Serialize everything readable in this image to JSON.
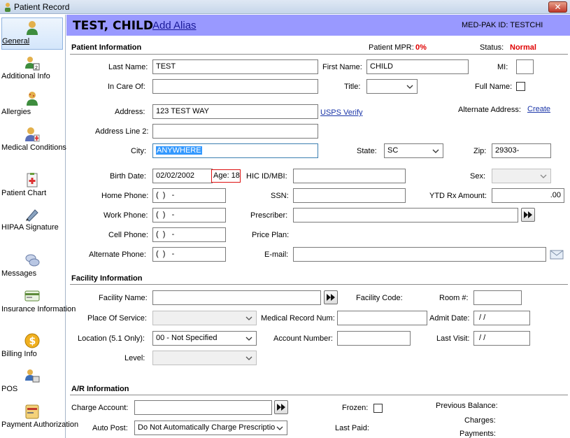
{
  "window": {
    "title": "Patient Record",
    "close_glyph": "✕"
  },
  "sidebar": {
    "items": [
      {
        "label": "General",
        "icon": "person-icon"
      },
      {
        "label": "Additional Info",
        "icon": "people-icon"
      },
      {
        "label": "Allergies",
        "icon": "allergy-icon"
      },
      {
        "label": "Medical Conditions",
        "icon": "medical-icon"
      },
      {
        "label": "Patient Chart",
        "icon": "chart-icon"
      },
      {
        "label": "HIPAA Signature",
        "icon": "pen-icon"
      },
      {
        "label": "Messages",
        "icon": "messages-icon"
      },
      {
        "label": "Insurance Information",
        "icon": "insurance-icon"
      },
      {
        "label": "Billing Info",
        "icon": "dollar-icon"
      },
      {
        "label": "POS",
        "icon": "pos-icon"
      },
      {
        "label": "Payment Authorization",
        "icon": "card-icon"
      }
    ]
  },
  "header": {
    "name": "TEST, CHILD",
    "add_alias": "Add Alias",
    "medpak_id": "MED-PAK ID: TESTCHI",
    "bg": "#9999ff"
  },
  "patient_info": {
    "title": "Patient Information",
    "mpr_label": "Patient MPR:",
    "mpr_value": "0%",
    "status_label": "Status:",
    "status_value": "Normal",
    "last_name_label": "Last Name:",
    "last_name": "TEST",
    "first_name_label": "First Name:",
    "first_name": "CHILD",
    "mi_label": "MI:",
    "mi": "",
    "in_care_of_label": "In Care Of:",
    "in_care_of": "",
    "title_label": "Title:",
    "title_value": "",
    "full_name_label": "Full Name:",
    "address_label": "Address:",
    "address": "123 TEST WAY",
    "usps_verify": "USPS Verify",
    "alt_address_label": "Alternate Address:",
    "create_link": "Create",
    "address2_label": "Address Line 2:",
    "address2": "",
    "city_label": "City:",
    "city": "ANYWHERE",
    "state_label": "State:",
    "state": "SC",
    "zip_label": "Zip:",
    "zip": "29303-",
    "birth_label": "Birth Date:",
    "birth_date": "02/02/2002",
    "age": "Age: 18",
    "hic_label": "HIC ID/MBI:",
    "hic": "",
    "sex_label": "Sex:",
    "sex": "",
    "home_phone_label": "Home Phone:",
    "home_phone": "(  )   -",
    "ssn_label": "SSN:",
    "ssn": "",
    "ytd_label": "YTD Rx Amount:",
    "ytd": ".00",
    "work_phone_label": "Work Phone:",
    "work_phone": "(  )   -",
    "prescriber_label": "Prescriber:",
    "prescriber": "",
    "cell_phone_label": "Cell Phone:",
    "cell_phone": "(  )   -",
    "price_plan_label": "Price Plan:",
    "alt_phone_label": "Alternate Phone:",
    "alt_phone": "(  )   -",
    "email_label": "E-mail:",
    "email": ""
  },
  "facility": {
    "title": "Facility Information",
    "name_label": "Facility Name:",
    "name": "",
    "code_label": "Facility Code:",
    "room_label": "Room #:",
    "room": "",
    "pos_label": "Place Of Service:",
    "pos": "",
    "mrn_label": "Medical Record Num:",
    "mrn": "",
    "admit_label": "Admit Date:",
    "admit": " / /",
    "location_label": "Location (5.1 Only):",
    "location": "00 - Not Specified",
    "account_label": "Account Number:",
    "account": "",
    "last_visit_label": "Last Visit:",
    "last_visit": " / /",
    "level_label": "Level:",
    "level": ""
  },
  "ar": {
    "title": "A/R Information",
    "charge_label": "Charge Account:",
    "charge": "",
    "frozen_label": "Frozen:",
    "prev_balance_label": "Previous Balance:",
    "charges_label": "Charges:",
    "auto_post_label": "Auto Post:",
    "auto_post": "Do Not Automatically Charge Prescription",
    "last_paid_label": "Last Paid:",
    "payments_label": "Payments:"
  }
}
